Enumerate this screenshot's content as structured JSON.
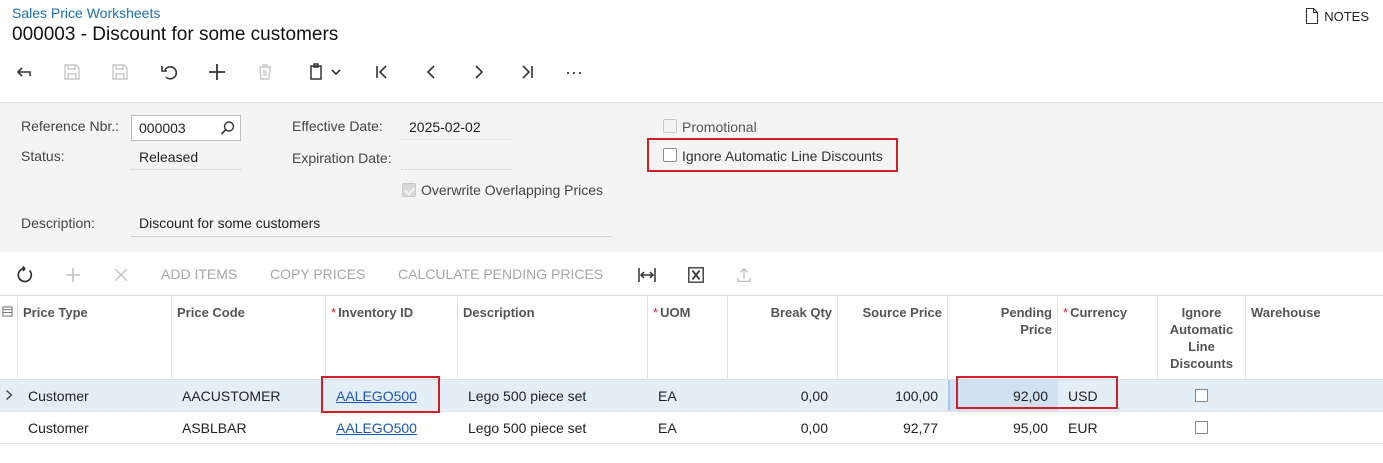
{
  "header": {
    "breadcrumb": "Sales Price Worksheets",
    "title": "000003 - Discount for some customers",
    "notes_label": "NOTES"
  },
  "toolbar": {
    "icons": [
      "back-icon",
      "save-close-icon",
      "save-icon",
      "undo-icon",
      "add-icon",
      "delete-icon",
      "copy-paste-icon",
      "chevron-down-icon",
      "first-record-icon",
      "previous-record-icon",
      "next-record-icon",
      "last-record-icon",
      "more-icon"
    ],
    "more_label": "···"
  },
  "form": {
    "reference_nbr_label": "Reference Nbr.:",
    "reference_nbr_value": "000003",
    "status_label": "Status:",
    "status_value": "Released",
    "effective_date_label": "Effective Date:",
    "effective_date_value": "2025-02-02",
    "expiration_date_label": "Expiration Date:",
    "expiration_date_value": "",
    "overwrite_label": "Overwrite Overlapping Prices",
    "overwrite_checked": true,
    "promotional_label": "Promotional",
    "promotional_checked": false,
    "ignore_discounts_label": "Ignore Automatic Line Discounts",
    "ignore_discounts_checked": false,
    "description_label": "Description:",
    "description_value": "Discount for some customers"
  },
  "grid_toolbar": {
    "add_items": "ADD ITEMS",
    "copy_prices": "COPY PRICES",
    "calculate_pending": "CALCULATE PENDING PRICES"
  },
  "grid": {
    "columns": {
      "price_type": "Price Type",
      "price_code": "Price Code",
      "inventory_id": "Inventory ID",
      "description": "Description",
      "uom": "UOM",
      "break_qty": "Break Qty",
      "source_price": "Source Price",
      "pending_price_1": "Pending",
      "pending_price_2": "Price",
      "currency": "Currency",
      "ignore_1": "Ignore",
      "ignore_2": "Automatic",
      "ignore_3": "Line",
      "ignore_4": "Discounts",
      "warehouse": "Warehouse"
    },
    "rows": [
      {
        "price_type": "Customer",
        "price_code": "AACUSTOMER",
        "inventory_id": "AALEGO500",
        "description": "Lego 500 piece set",
        "uom": "EA",
        "break_qty": "0,00",
        "source_price": "100,00",
        "pending_price": "92,00",
        "currency": "USD",
        "ignore_discounts": false,
        "warehouse": ""
      },
      {
        "price_type": "Customer",
        "price_code": "ASBLBAR",
        "inventory_id": "AALEGO500",
        "description": "Lego 500 piece set",
        "uom": "EA",
        "break_qty": "0,00",
        "source_price": "92,77",
        "pending_price": "95,00",
        "currency": "EUR",
        "ignore_discounts": false,
        "warehouse": ""
      }
    ]
  },
  "colors": {
    "accent": "#1a6fb5",
    "highlight_box": "#d2202a",
    "selected_row": "#e4eef7"
  }
}
